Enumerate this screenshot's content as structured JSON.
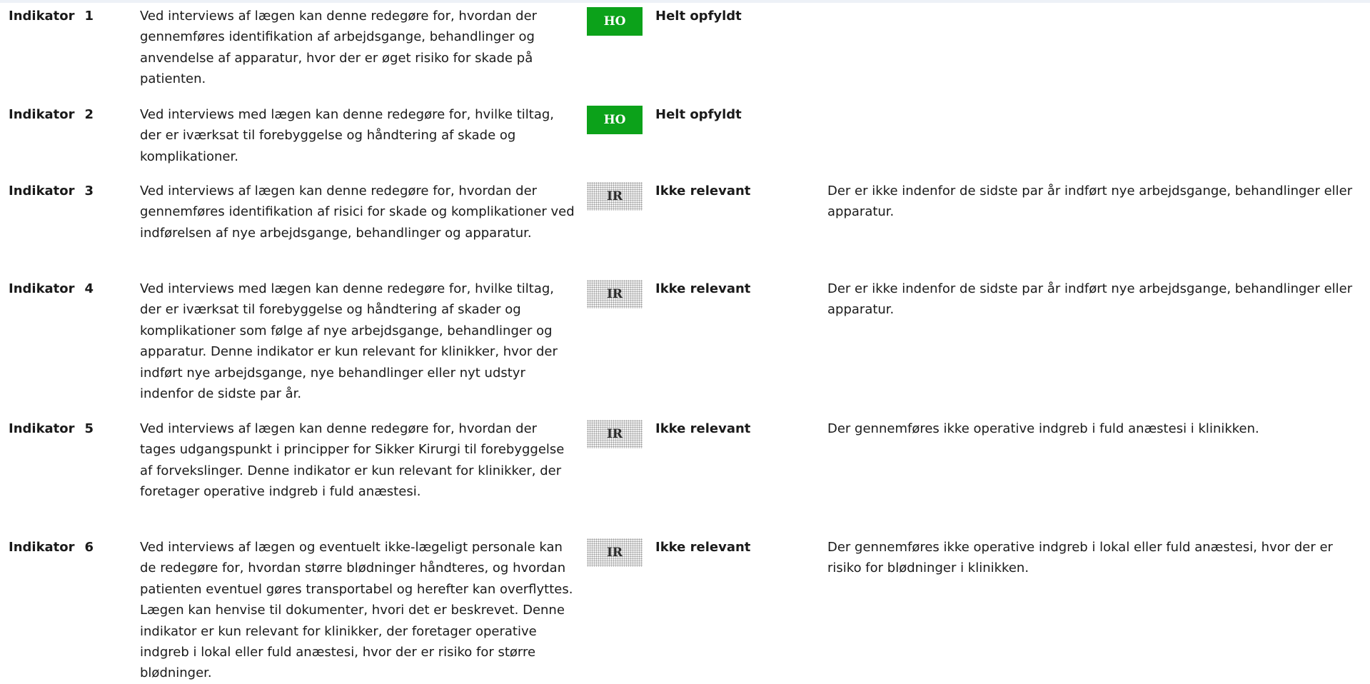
{
  "indicator_word": "Indikator",
  "rows": [
    {
      "number": "1",
      "description": "Ved interviews af lægen kan denne redegøre for, hvordan der gennemføres identifikation af arbejdsgange, behandlinger og anvendelse af apparatur, hvor der er øget risiko for skade på patienten.",
      "badge": "HO",
      "status": "Helt opfyldt",
      "comment": ""
    },
    {
      "number": "2",
      "description": "Ved interviews med lægen kan denne redegøre for, hvilke tiltag, der er iværksat til forebyggelse og håndtering af skade og komplikationer.",
      "badge": "HO",
      "status": "Helt opfyldt",
      "comment": ""
    },
    {
      "number": "3",
      "description": "Ved interviews af lægen kan denne redegøre for, hvordan der gennemføres identifikation af risici for skade og komplikationer ved indførelsen af nye arbejdsgange, behandlinger og apparatur.",
      "badge": "IR",
      "status": "Ikke relevant",
      "comment": "Der er ikke indenfor de sidste par år indført nye arbejdsgange, behandlinger eller apparatur."
    },
    {
      "number": "4",
      "description": "Ved interviews med lægen kan denne redegøre for, hvilke tiltag, der er iværksat til forebyggelse og håndtering af skader og komplikationer som følge af nye arbejdsgange, behandlinger og apparatur.   Denne indikator er kun relevant for klinikker, hvor der indført nye arbejdsgange, nye behandlinger eller nyt udstyr indenfor de sidste par år.",
      "badge": "IR",
      "status": "Ikke relevant",
      "comment": "Der er ikke indenfor de sidste par år indført nye arbejdsgange, behandlinger eller apparatur."
    },
    {
      "number": "5",
      "description": "Ved interviews af lægen kan denne redegøre for, hvordan der tages udgangspunkt i principper for Sikker Kirurgi til forebyggelse af forvekslinger.   Denne indikator er kun relevant for klinikker, der foretager operative indgreb i fuld anæstesi.",
      "badge": "IR",
      "status": "Ikke relevant",
      "comment": "Der gennemføres ikke operative indgreb i fuld anæstesi i klinikken."
    },
    {
      "number": "6",
      "description": "Ved interviews af lægen og eventuelt ikke-lægeligt personale kan de redegøre for, hvordan større blødninger håndteres, og hvordan patienten eventuel gøres transportabel og herefter kan overflyttes. Lægen kan henvise til dokumenter, hvori det er beskrevet.   Denne indikator er kun relevant for klinikker, der foretager operative indgreb i lokal eller fuld anæstesi, hvor der er risiko for større blødninger.",
      "badge": "IR",
      "status": "Ikke relevant",
      "comment": "Der gennemføres ikke operative indgreb i lokal eller fuld anæstesi, hvor der er risiko for blødninger i klinikken."
    }
  ]
}
